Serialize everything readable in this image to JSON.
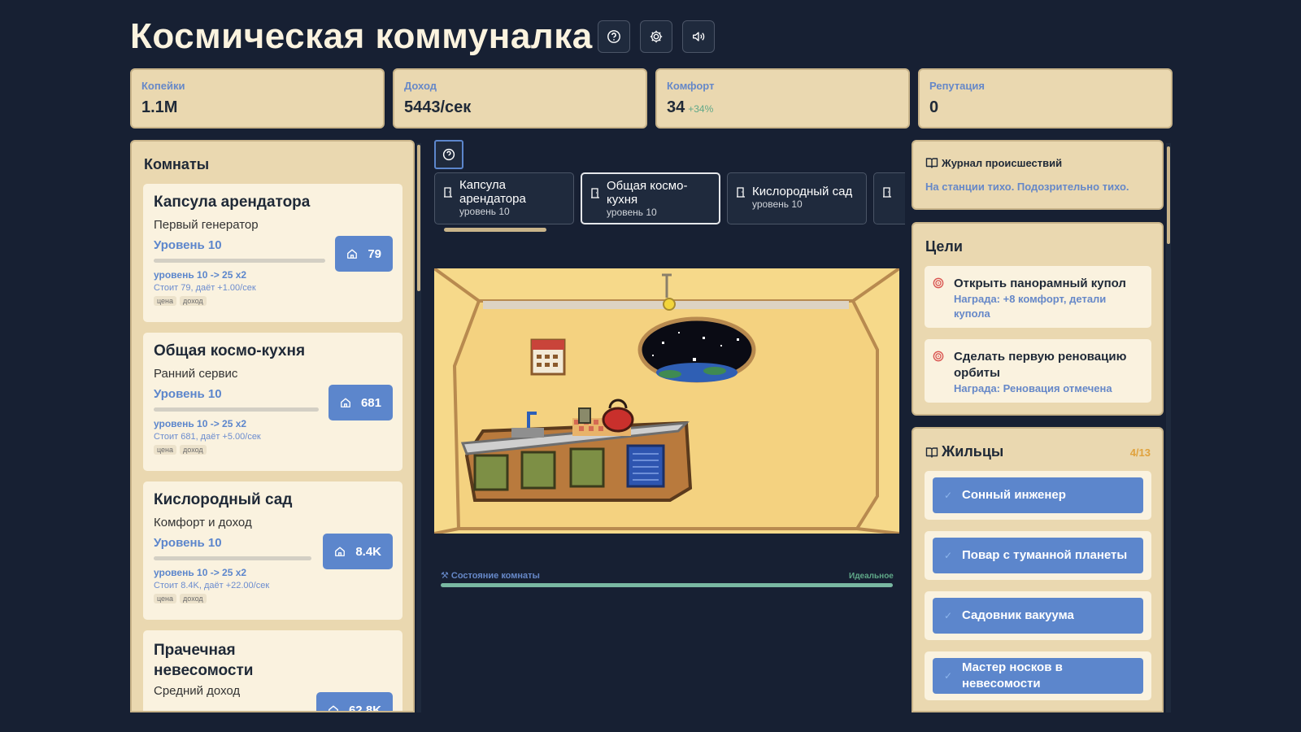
{
  "header": {
    "title": "Космическая коммуналка",
    "help_icon": "question-circle-icon",
    "settings_icon": "gear-icon",
    "sound_icon": "speaker-icon"
  },
  "stats": [
    {
      "label": "Копейки",
      "value": "1.1M",
      "extra": ""
    },
    {
      "label": "Доход",
      "value": "5443/сек",
      "extra": ""
    },
    {
      "label": "Комфорт",
      "value": "34",
      "extra": "+34%"
    },
    {
      "label": "Репутация",
      "value": "0",
      "extra": ""
    }
  ],
  "rooms": {
    "title": "Комнаты",
    "items": [
      {
        "name": "Капсула арендатора",
        "subtitle": "Первый генератор",
        "level": "Уровень 10",
        "upgrade": "уровень 10 -> 25 x2",
        "cost": "Стоит 79, даёт +1.00/сек",
        "tags": [
          "цена",
          "доход"
        ],
        "price": "79"
      },
      {
        "name": "Общая космо-кухня",
        "subtitle": "Ранний сервис",
        "level": "Уровень 10",
        "upgrade": "уровень 10 -> 25 x2",
        "cost": "Стоит 681, даёт +5.00/сек",
        "tags": [
          "цена",
          "доход"
        ],
        "price": "681"
      },
      {
        "name": "Кислородный сад",
        "subtitle": "Комфорт и доход",
        "level": "Уровень 10",
        "upgrade": "уровень 10 -> 25 x2",
        "cost": "Стоит 8.4K, даёт +22.00/сек",
        "tags": [
          "цена",
          "доход"
        ],
        "price": "8.4K"
      },
      {
        "name": "Прачечная невесомости",
        "subtitle": "Средний доход",
        "level": "",
        "upgrade": "",
        "cost": "",
        "tags": [],
        "price": "62.8K"
      }
    ]
  },
  "tabs": [
    {
      "name": "Капсула арендатора",
      "level": "уровень 10"
    },
    {
      "name": "Общая космо-кухня",
      "level": "уровень 10"
    },
    {
      "name": "Кислородный сад",
      "level": "уровень 10"
    }
  ],
  "condition": {
    "label": "Состояние комнаты",
    "value": "Идеальное",
    "fraction": 1.0
  },
  "log": {
    "title": "Журнал происшествий",
    "text": "На станции тихо. Подозрительно тихо."
  },
  "goals": {
    "title": "Цели",
    "items": [
      {
        "name": "Открыть панорамный купол",
        "reward": "Награда: +8 комфорт, детали купола"
      },
      {
        "name": "Сделать первую реновацию орбиты",
        "reward": "Награда: Реновация отмечена"
      }
    ]
  },
  "residents": {
    "title": "Жильцы",
    "count": "4/13",
    "items": [
      "Сонный инженер",
      "Повар с туманной планеты",
      "Садовник вакуума",
      "Мастер носков в невесомости"
    ]
  },
  "colors": {
    "background": "#172033",
    "card": "#ead8b0",
    "accent": "#5c86cc",
    "good": "#5fa888",
    "warn": "#e0a23d"
  }
}
